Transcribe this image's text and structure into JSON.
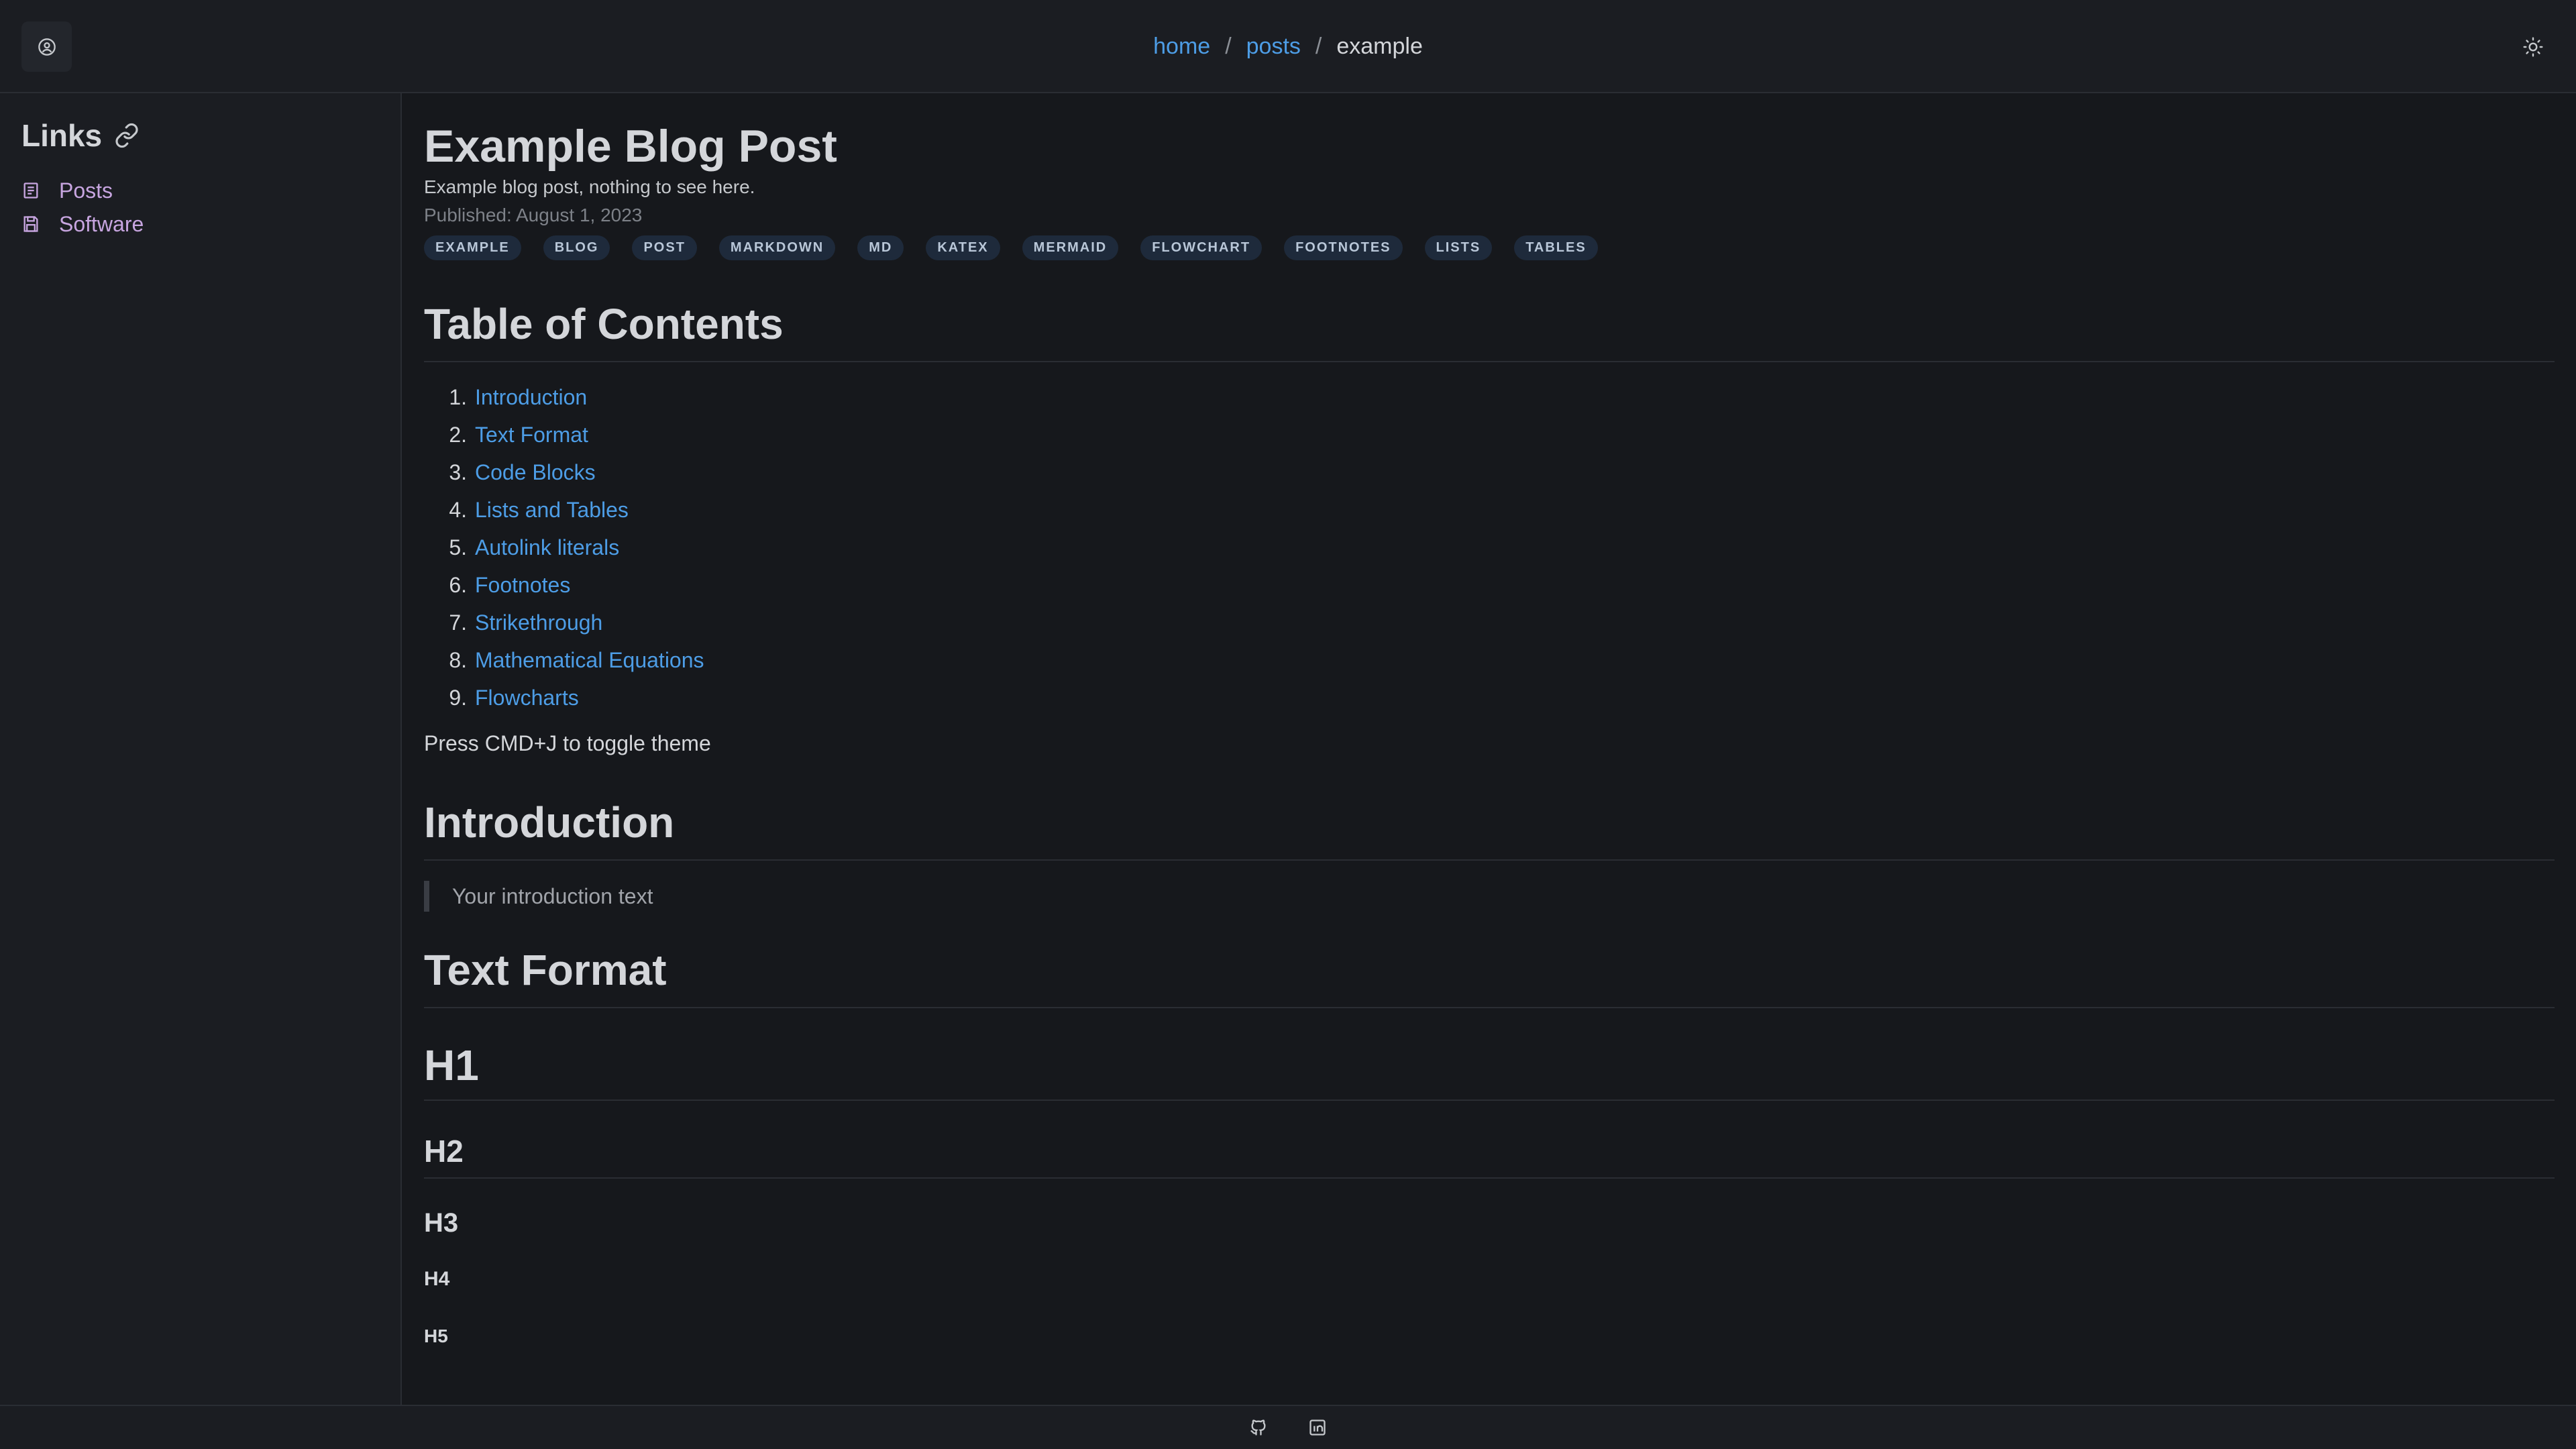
{
  "header": {
    "breadcrumb": [
      {
        "label": "home",
        "link": true
      },
      {
        "label": "posts",
        "link": true
      },
      {
        "label": "example",
        "link": false
      }
    ],
    "separator": "/",
    "avatar_icon": "user-circle-icon",
    "theme_icon": "sun-icon"
  },
  "sidebar": {
    "title": "Links",
    "title_icon": "link-icon",
    "items": [
      {
        "label": "Posts",
        "icon": "document-icon"
      },
      {
        "label": "Software",
        "icon": "save-icon"
      }
    ]
  },
  "post": {
    "title": "Example Blog Post",
    "description": "Example blog post, nothing to see here.",
    "published": "Published: August 1, 2023",
    "tags": [
      "EXAMPLE",
      "BLOG",
      "POST",
      "MARKDOWN",
      "MD",
      "KATEX",
      "MERMAID",
      "FLOWCHART",
      "FOOTNOTES",
      "LISTS",
      "TABLES"
    ]
  },
  "toc": {
    "heading": "Table of Contents",
    "items": [
      {
        "num": "1.",
        "label": "Introduction"
      },
      {
        "num": "2.",
        "label": "Text Format"
      },
      {
        "num": "3.",
        "label": "Code Blocks"
      },
      {
        "num": "4.",
        "label": "Lists and Tables"
      },
      {
        "num": "5.",
        "label": "Autolink literals"
      },
      {
        "num": "6.",
        "label": "Footnotes"
      },
      {
        "num": "7.",
        "label": "Strikethrough"
      },
      {
        "num": "8.",
        "label": "Mathematical Equations"
      },
      {
        "num": "9.",
        "label": "Flowcharts"
      }
    ]
  },
  "theme_hint": "Press CMD+J to toggle theme",
  "introduction": {
    "heading": "Introduction",
    "quote": "Your introduction text"
  },
  "text_format": {
    "heading": "Text Format",
    "h1": "H1",
    "h2": "H2",
    "h3": "H3",
    "h4": "H4",
    "h5": "H5"
  },
  "footer": {
    "icons": [
      "github-icon",
      "linkedin-icon"
    ]
  },
  "colors": {
    "background": "#16181c",
    "panel": "#1b1d22",
    "link": "#4d9de6",
    "sidebar_link": "#c7a5e0",
    "tag_bg": "#1e2a3b"
  }
}
